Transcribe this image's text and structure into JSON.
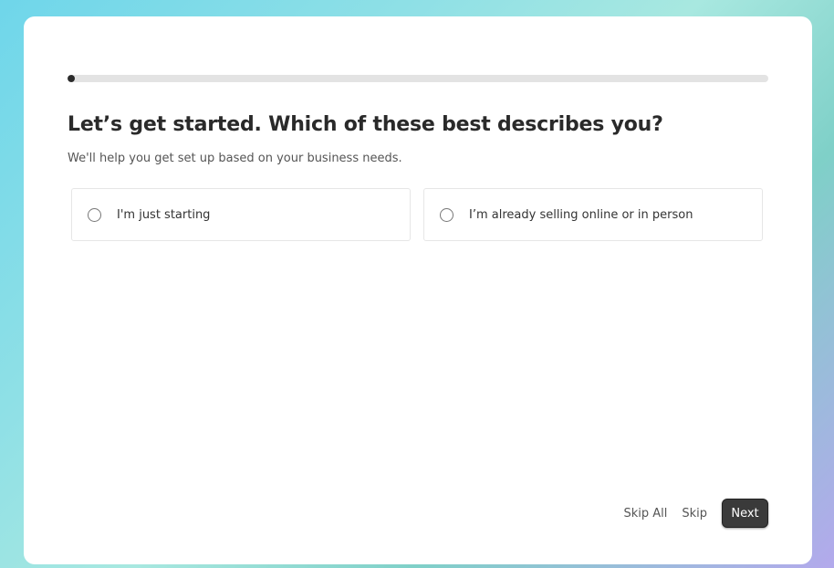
{
  "progress": {
    "percent": 1
  },
  "title": "Let’s get started. Which of these best describes you?",
  "subtitle": "We'll help you get set up based on your business needs.",
  "options": [
    {
      "label": "I'm just starting",
      "selected": false
    },
    {
      "label": "I’m already selling online or in person",
      "selected": false
    }
  ],
  "footer": {
    "skip_all": "Skip All",
    "skip": "Skip",
    "next": "Next"
  },
  "colors": {
    "accent": "#3a3a3a"
  }
}
